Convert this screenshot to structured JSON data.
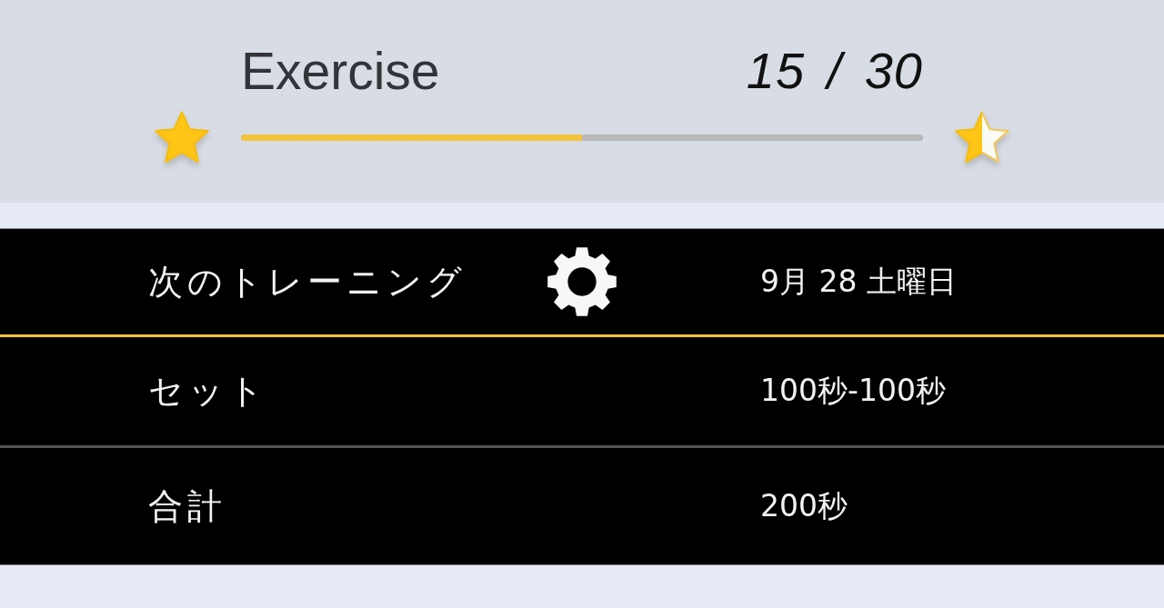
{
  "header": {
    "title": "Exercise",
    "count": "15 / 30",
    "level": 0.5,
    "stars": [
      {
        "kind": "filled"
      },
      {
        "kind": "half-filled"
      }
    ]
  },
  "rows": [
    {
      "kind": "settings",
      "label": "次のトレーニング",
      "value": "9月 28 土曜日"
    },
    {
      "kind": "plain",
      "label": "セット",
      "value": "100秒-100秒"
    },
    {
      "kind": "plain",
      "label": "合計",
      "value": "200秒"
    }
  ]
}
